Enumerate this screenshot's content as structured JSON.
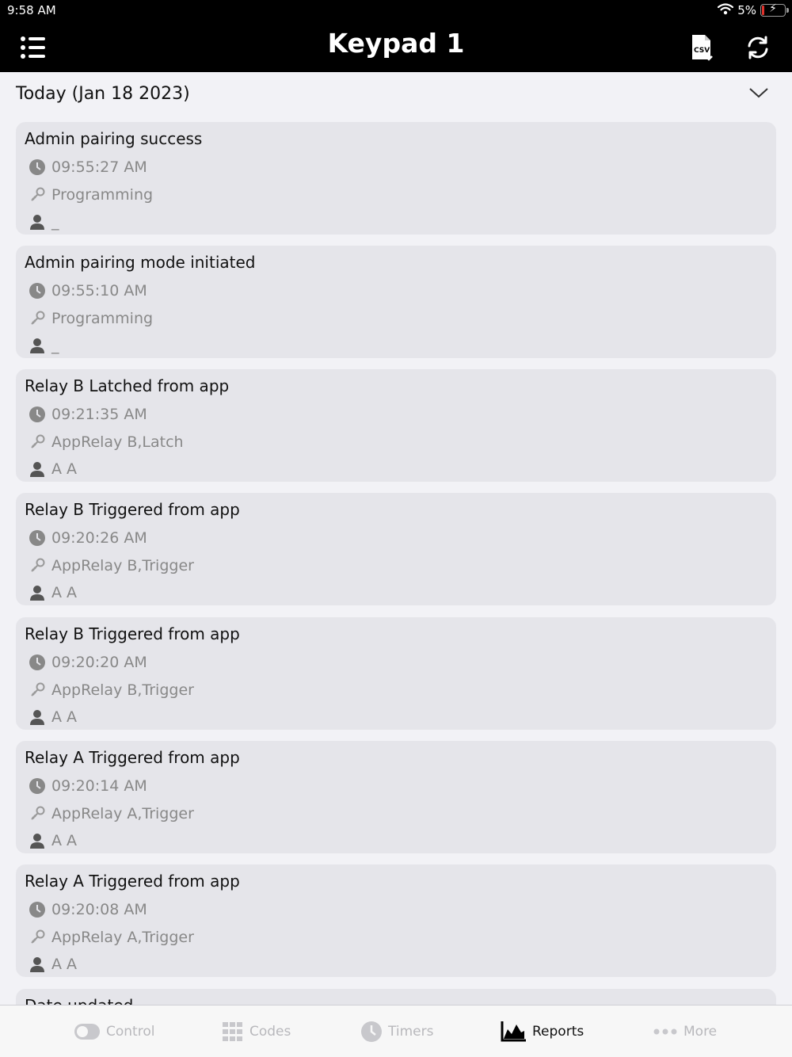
{
  "status_bar": {
    "time": "9:58 AM",
    "battery_percent": "5%"
  },
  "nav": {
    "title": "Keypad 1",
    "menu_icon": "list-icon",
    "csv_icon": "csv-export-icon",
    "refresh_icon": "refresh-icon"
  },
  "section": {
    "title": "Today (Jan 18 2023)"
  },
  "events": [
    {
      "title": "Admin pairing success",
      "time": "09:55:27 AM",
      "action": "Programming",
      "user": "_"
    },
    {
      "title": "Admin pairing mode initiated",
      "time": "09:55:10 AM",
      "action": "Programming",
      "user": "_"
    },
    {
      "title": "Relay B Latched from app",
      "time": "09:21:35 AM",
      "action": "AppRelay B,Latch",
      "user": "A A"
    },
    {
      "title": "Relay B Triggered from app",
      "time": "09:20:26 AM",
      "action": "AppRelay B,Trigger",
      "user": "A A"
    },
    {
      "title": "Relay B Triggered from app",
      "time": "09:20:20 AM",
      "action": "AppRelay B,Trigger",
      "user": "A A"
    },
    {
      "title": "Relay A Triggered from app",
      "time": "09:20:14 AM",
      "action": "AppRelay A,Trigger",
      "user": "A A"
    },
    {
      "title": "Relay A Triggered from app",
      "time": "09:20:08 AM",
      "action": "AppRelay A,Trigger",
      "user": "A A"
    },
    {
      "title": "Date updated",
      "time": "",
      "action": "",
      "user": ""
    }
  ],
  "tabs": [
    {
      "label": "Control",
      "icon": "toggle-icon",
      "active": false
    },
    {
      "label": "Codes",
      "icon": "grid-icon",
      "active": false
    },
    {
      "label": "Timers",
      "icon": "clock-icon",
      "active": false
    },
    {
      "label": "Reports",
      "icon": "chart-icon",
      "active": true
    },
    {
      "label": "More",
      "icon": "more-dots-icon",
      "active": false
    }
  ],
  "colors": {
    "header_bg": "#000000",
    "card_bg": "#e5e5ea",
    "muted_text": "#888888",
    "active_tab": "#111111",
    "inactive_tab": "#b8b8bc"
  }
}
